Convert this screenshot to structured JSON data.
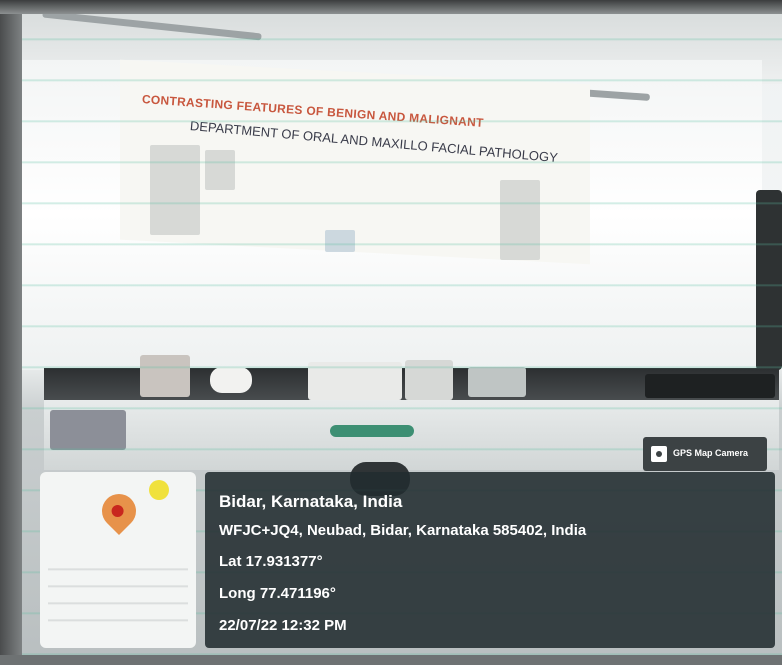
{
  "poster": {
    "headline": "CONTRASTING FEATURES OF BENIGN AND MALIGNANT",
    "department": "DEPARTMENT OF ORAL AND MAXILLO FACIAL PATHOLOGY"
  },
  "gps_badge": {
    "label": "GPS Map Camera"
  },
  "location": {
    "place": "Bidar, Karnataka, India",
    "address": "WFJC+JQ4, Neubad, Bidar, Karnataka 585402, India",
    "latitude": "Lat 17.931377°",
    "longitude": "Long 77.471196°",
    "datetime": "22/07/22 12:32 PM"
  },
  "colors": {
    "pin": "#e7924a",
    "pin_center": "#c8271e",
    "info_background": "#222c30"
  },
  "icons": {
    "map_pin": "location-pin-icon",
    "badge": "camera-icon"
  }
}
